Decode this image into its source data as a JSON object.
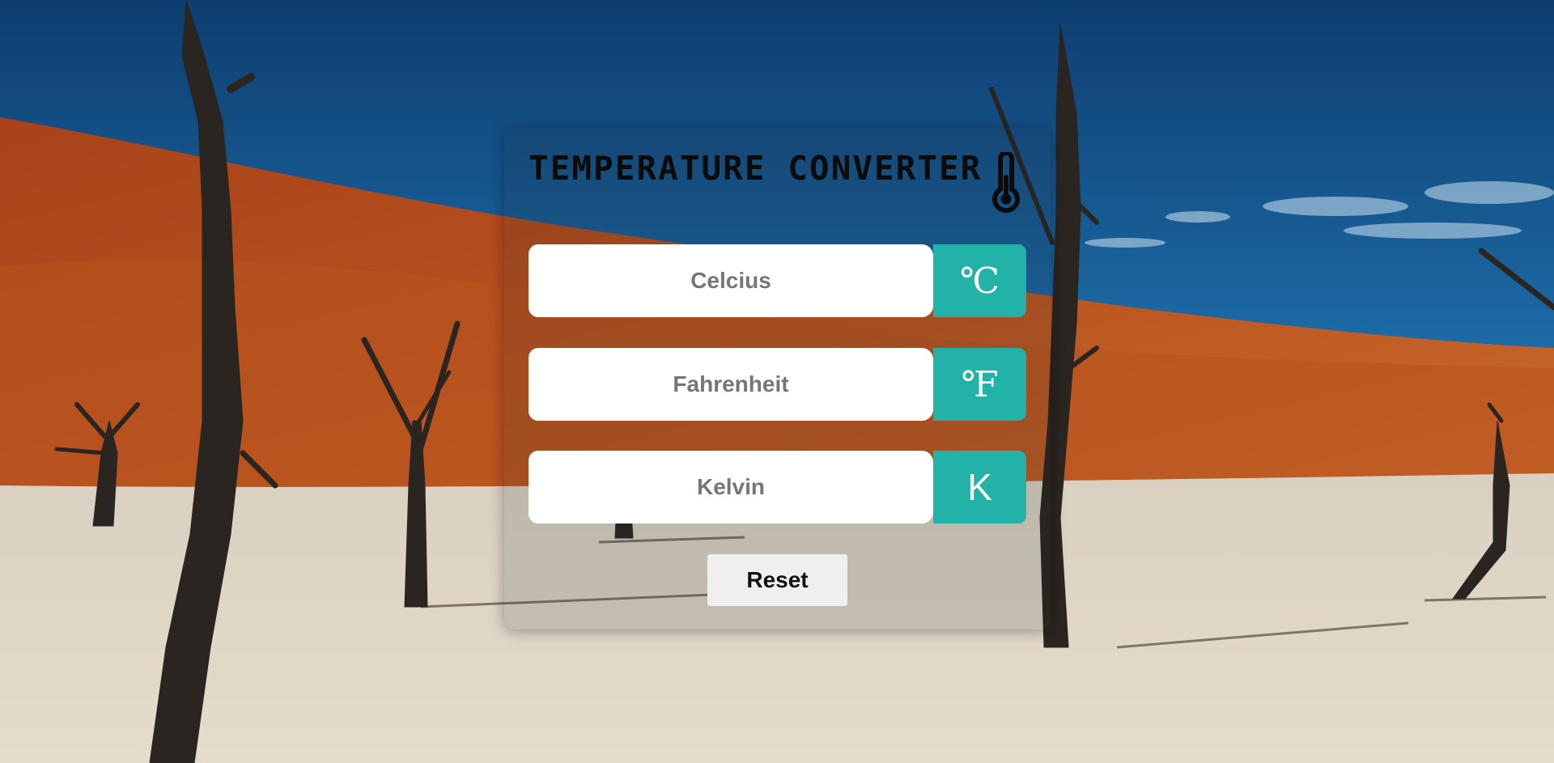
{
  "app": {
    "title": "TEMPERATURE CONVERTER",
    "title_icon": "thermometer-icon"
  },
  "fields": {
    "celsius": {
      "placeholder": "Celcius",
      "value": "",
      "unit": "℃"
    },
    "fahrenheit": {
      "placeholder": "Fahrenheit",
      "value": "",
      "unit": "℉"
    },
    "kelvin": {
      "placeholder": "Kelvin",
      "value": "",
      "unit": "K"
    }
  },
  "actions": {
    "reset_label": "Reset"
  },
  "colors": {
    "accent": "#22b2a7",
    "input_bg": "#ffffff",
    "button_bg": "#efefef",
    "sky": "#1a5d93",
    "dune": "#b04a1f",
    "pan": "#d8cfc0"
  }
}
